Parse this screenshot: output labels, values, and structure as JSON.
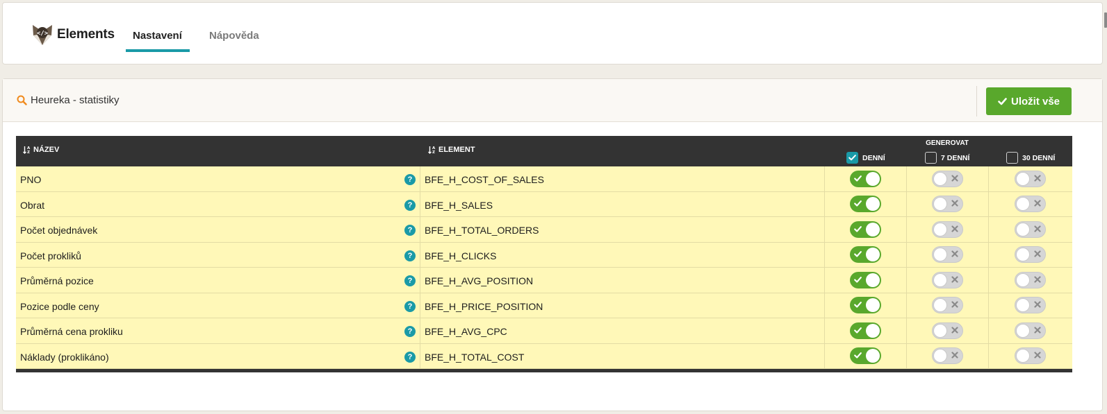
{
  "header": {
    "brand": "Elements",
    "tabs": [
      {
        "label": "Nastavení",
        "active": true
      },
      {
        "label": "Nápověda",
        "active": false
      }
    ]
  },
  "panel": {
    "title": "Heureka - statistiky",
    "save_label": "Uložit vše"
  },
  "table": {
    "col_name": "NÁZEV",
    "col_element": "ELEMENT",
    "generate_label": "GENEROVAT",
    "periods": [
      {
        "label": "DENNÍ",
        "checked": true
      },
      {
        "label": "7 DENNÍ",
        "checked": false
      },
      {
        "label": "30 DENNÍ",
        "checked": false
      }
    ],
    "rows": [
      {
        "name": "PNO",
        "element": "BFE_H_COST_OF_SALES",
        "daily": true,
        "weekly": false,
        "monthly": false
      },
      {
        "name": "Obrat",
        "element": "BFE_H_SALES",
        "daily": true,
        "weekly": false,
        "monthly": false
      },
      {
        "name": "Počet objednávek",
        "element": "BFE_H_TOTAL_ORDERS",
        "daily": true,
        "weekly": false,
        "monthly": false
      },
      {
        "name": "Počet prokliků",
        "element": "BFE_H_CLICKS",
        "daily": true,
        "weekly": false,
        "monthly": false
      },
      {
        "name": "Průměrná pozice",
        "element": "BFE_H_AVG_POSITION",
        "daily": true,
        "weekly": false,
        "monthly": false
      },
      {
        "name": "Pozice podle ceny",
        "element": "BFE_H_PRICE_POSITION",
        "daily": true,
        "weekly": false,
        "monthly": false
      },
      {
        "name": "Průměrná cena prokliku",
        "element": "BFE_H_AVG_CPC",
        "daily": true,
        "weekly": false,
        "monthly": false
      },
      {
        "name": "Náklady (proklikáno)",
        "element": "BFE_H_TOTAL_COST",
        "daily": true,
        "weekly": false,
        "monthly": false
      }
    ]
  },
  "colors": {
    "accent": "#1a9aa7",
    "success": "#59a82c",
    "row_bg": "#fff8b8",
    "header_bg": "#333333"
  },
  "icons": {
    "logo": "fox-code-logo-icon",
    "panel": "magnifier-icon",
    "save": "check-icon",
    "help": "question-icon",
    "sort": "sort-az-icon"
  }
}
